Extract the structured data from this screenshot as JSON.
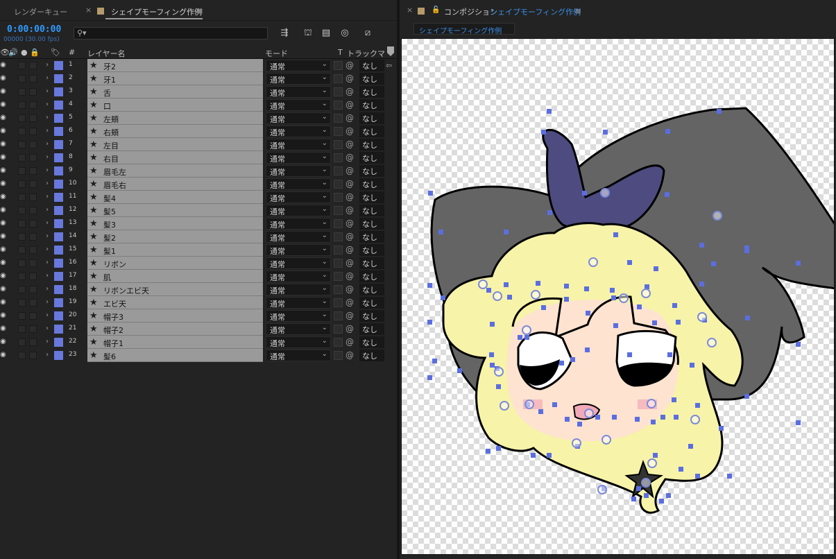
{
  "timeline": {
    "tab_render_queue": "レンダーキュー",
    "tab_close": "×",
    "tab_comp": "シェイプモーフィング作例",
    "menu_icon": "≡",
    "timecode": "0:00:00:00",
    "frames": "00000 (30.00 fps)",
    "search_placeholder": "",
    "columns": {
      "hash": "#",
      "layer_name": "レイヤー名",
      "mode": "モード",
      "t": "T",
      "track_matte": "トラックマッ"
    },
    "layers": [
      {
        "num": "1",
        "name": "牙2",
        "mode": "通常",
        "track": "なし"
      },
      {
        "num": "2",
        "name": "牙1",
        "mode": "通常",
        "track": "なし"
      },
      {
        "num": "3",
        "name": "舌",
        "mode": "通常",
        "track": "なし"
      },
      {
        "num": "4",
        "name": "口",
        "mode": "通常",
        "track": "なし"
      },
      {
        "num": "5",
        "name": "左頬",
        "mode": "通常",
        "track": "なし"
      },
      {
        "num": "6",
        "name": "右頬",
        "mode": "通常",
        "track": "なし"
      },
      {
        "num": "7",
        "name": "左目",
        "mode": "通常",
        "track": "なし"
      },
      {
        "num": "8",
        "name": "右目",
        "mode": "通常",
        "track": "なし"
      },
      {
        "num": "9",
        "name": "眉毛左",
        "mode": "通常",
        "track": "なし"
      },
      {
        "num": "10",
        "name": "眉毛右",
        "mode": "通常",
        "track": "なし"
      },
      {
        "num": "11",
        "name": "髪4",
        "mode": "通常",
        "track": "なし"
      },
      {
        "num": "12",
        "name": "髪5",
        "mode": "通常",
        "track": "なし"
      },
      {
        "num": "13",
        "name": "髪3",
        "mode": "通常",
        "track": "なし"
      },
      {
        "num": "14",
        "name": "髪2",
        "mode": "通常",
        "track": "なし"
      },
      {
        "num": "15",
        "name": "髪1",
        "mode": "通常",
        "track": "なし"
      },
      {
        "num": "16",
        "name": "リボン",
        "mode": "通常",
        "track": "なし"
      },
      {
        "num": "17",
        "name": "肌",
        "mode": "通常",
        "track": "なし"
      },
      {
        "num": "18",
        "name": "リボンエビ天",
        "mode": "通常",
        "track": "なし"
      },
      {
        "num": "19",
        "name": "エビ天",
        "mode": "通常",
        "track": "なし"
      },
      {
        "num": "20",
        "name": "帽子3",
        "mode": "通常",
        "track": "なし"
      },
      {
        "num": "21",
        "name": "帽子2",
        "mode": "通常",
        "track": "なし"
      },
      {
        "num": "22",
        "name": "帽子1",
        "mode": "通常",
        "track": "なし"
      },
      {
        "num": "23",
        "name": "髪6",
        "mode": "通常",
        "track": "なし"
      }
    ]
  },
  "composition": {
    "close": "×",
    "lock_icon": "lock-icon",
    "title_prefix": "コンポジション",
    "title_comp": "シェイプモーフィング作例",
    "menu_icon": "≡",
    "subtab": "シェイプモーフィング作例"
  },
  "colors": {
    "accent": "#2f9bff",
    "label": "#6878dc",
    "hat": "#646464",
    "ribbon": "#4d4b80",
    "hair": "#f7f3a8",
    "skin": "#fde3d0",
    "handle": "#5b6ee0"
  }
}
